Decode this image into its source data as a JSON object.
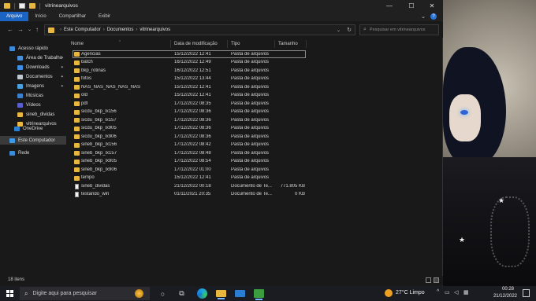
{
  "window": {
    "title": "vitrinearquivos",
    "controls": {
      "minimize": "—",
      "maximize": "☐",
      "close": "✕"
    }
  },
  "ribbon": {
    "tabs": [
      "Arquivo",
      "Início",
      "Compartilhar",
      "Exibir"
    ],
    "active_tab": "Arquivo",
    "expand_glyph": "⌄",
    "help_glyph": "?"
  },
  "navigation": {
    "back": "←",
    "forward": "→",
    "recent": "⌄",
    "up": "↑",
    "breadcrumb": [
      "Este Computador",
      "Documentos",
      "vitrinearquivos"
    ],
    "breadcrumb_sep": "›",
    "dropdown": "⌄",
    "refresh": "↻",
    "search_placeholder": "Pesquisar em vitrinearquivos"
  },
  "sidebar": {
    "items": [
      {
        "label": "Acesso rápido",
        "icon": "star-icon",
        "color": "#3d8bd8",
        "pinned": false
      },
      {
        "label": "Área de Trabalho",
        "icon": "desktop-icon",
        "color": "#4a90d9",
        "pinned": true
      },
      {
        "label": "Downloads",
        "icon": "download-icon",
        "color": "#3a8ee6",
        "pinned": true
      },
      {
        "label": "Documentos",
        "icon": "documents-icon",
        "color": "#bfc7d1",
        "pinned": true
      },
      {
        "label": "Imagens",
        "icon": "pictures-icon",
        "color": "#4aa3e0",
        "pinned": true
      },
      {
        "label": "Músicas",
        "icon": "music-icon",
        "color": "#3b7fd0",
        "pinned": false
      },
      {
        "label": "Vídeos",
        "icon": "videos-icon",
        "color": "#5a5fd0",
        "pinned": false
      },
      {
        "label": "sineb_dividas",
        "icon": "folder-icon",
        "color": "#e8b73d",
        "pinned": false
      },
      {
        "label": "vitrinearquivos",
        "icon": "folder-icon",
        "color": "#e8b73d",
        "pinned": false
      },
      {
        "label": "OneDrive",
        "icon": "onedrive-icon",
        "color": "#2a7fd6",
        "pinned": false
      },
      {
        "label": "Este Computador",
        "icon": "computer-icon",
        "color": "#3d9ae8",
        "pinned": false,
        "selected": true
      },
      {
        "label": "Rede",
        "icon": "network-icon",
        "color": "#3d8bd8",
        "pinned": false
      }
    ],
    "pin_glyph": "📌"
  },
  "columns": {
    "name": "Nome",
    "modified": "Data de modificação",
    "type": "Tipo",
    "size": "Tamanho",
    "sort_caret": "⌃"
  },
  "files": [
    {
      "name": "Agencias",
      "modified": "15/12/2022 12:41",
      "type": "Pasta de arquivos",
      "size": "",
      "kind": "folder",
      "focused": true
    },
    {
      "name": "batch",
      "modified": "16/12/2022 12:49",
      "type": "Pasta de arquivos",
      "size": "",
      "kind": "folder"
    },
    {
      "name": "bkp_rotinas",
      "modified": "16/12/2022 12:51",
      "type": "Pasta de arquivos",
      "size": "",
      "kind": "folder"
    },
    {
      "name": "fotos",
      "modified": "15/12/2022 13:44",
      "type": "Pasta de arquivos",
      "size": "",
      "kind": "folder"
    },
    {
      "name": "NAS_NAS_NAS_NAS_NAS",
      "modified": "15/12/2022 12:41",
      "type": "Pasta de arquivos",
      "size": "",
      "kind": "folder"
    },
    {
      "name": "old",
      "modified": "15/12/2022 12:41",
      "type": "Pasta de arquivos",
      "size": "",
      "kind": "folder"
    },
    {
      "name": "pdf",
      "modified": "17/12/2022 08:35",
      "type": "Pasta de arquivos",
      "size": "",
      "kind": "folder"
    },
    {
      "name": "sicdu_bkp_lx156",
      "modified": "17/12/2022 08:36",
      "type": "Pasta de arquivos",
      "size": "",
      "kind": "folder"
    },
    {
      "name": "sicdu_bkp_lx157",
      "modified": "17/12/2022 08:36",
      "type": "Pasta de arquivos",
      "size": "",
      "kind": "folder"
    },
    {
      "name": "sicdu_bkp_lx905",
      "modified": "17/12/2022 08:36",
      "type": "Pasta de arquivos",
      "size": "",
      "kind": "folder"
    },
    {
      "name": "sicdu_bkp_lx906",
      "modified": "17/12/2022 08:36",
      "type": "Pasta de arquivos",
      "size": "",
      "kind": "folder"
    },
    {
      "name": "sineb_bkp_lx156",
      "modified": "17/12/2022 08:42",
      "type": "Pasta de arquivos",
      "size": "",
      "kind": "folder"
    },
    {
      "name": "sineb_bkp_lx157",
      "modified": "17/12/2022 08:48",
      "type": "Pasta de arquivos",
      "size": "",
      "kind": "folder"
    },
    {
      "name": "sineb_bkp_lx905",
      "modified": "17/12/2022 08:54",
      "type": "Pasta de arquivos",
      "size": "",
      "kind": "folder"
    },
    {
      "name": "sineb_bkp_lx906",
      "modified": "17/12/2022 01:00",
      "type": "Pasta de arquivos",
      "size": "",
      "kind": "folder"
    },
    {
      "name": "tempo",
      "modified": "15/12/2022 12:41",
      "type": "Pasta de arquivos",
      "size": "",
      "kind": "folder"
    },
    {
      "name": "sineb_dividas",
      "modified": "21/12/2022 00:18",
      "type": "Documento de Te...",
      "size": "771.805 KB",
      "kind": "doc"
    },
    {
      "name": "testando_win",
      "modified": "01/11/2021 20:35",
      "type": "Documento de Te...",
      "size": "0 KB",
      "kind": "doc"
    }
  ],
  "status": {
    "item_count": "18 itens"
  },
  "taskbar": {
    "search_placeholder": "Digite aqui para pesquisar",
    "search_glyph": "⌕",
    "taskview_glyph": "○",
    "widgets_glyph": "⧉",
    "weather_temp": "27°C  Limpo",
    "tray_chevron": "^",
    "time": "00:28",
    "date": "21/12/2022"
  }
}
